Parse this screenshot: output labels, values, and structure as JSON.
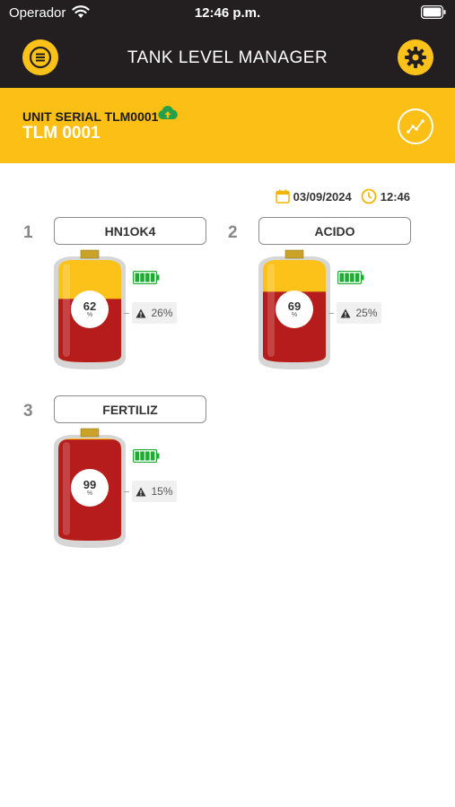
{
  "status_bar": {
    "carrier": "Operador",
    "time": "12:46 p.m."
  },
  "header": {
    "title": "TANK LEVEL MANAGER"
  },
  "unit": {
    "serial_label": "UNIT SERIAL TLM0001",
    "name": "TLM 0001"
  },
  "datetime": {
    "date": "03/09/2024",
    "time": "12:46"
  },
  "colors": {
    "accent": "#fbbf16",
    "header_bg": "#231f20",
    "liquid": "#b71c1c",
    "empty": "#fcc21a",
    "battery": "#1faa32",
    "cloud": "#22a04a"
  },
  "tanks": [
    {
      "index": "1",
      "name": "HN1OK4",
      "level": "62",
      "unit": "%",
      "alarm": "26%",
      "level_fraction": 0.62
    },
    {
      "index": "2",
      "name": "ACIDO",
      "level": "69",
      "unit": "%",
      "alarm": "25%",
      "level_fraction": 0.69
    },
    {
      "index": "3",
      "name": "FERTILIZ",
      "level": "99",
      "unit": "%",
      "alarm": "15%",
      "level_fraction": 0.99
    }
  ]
}
